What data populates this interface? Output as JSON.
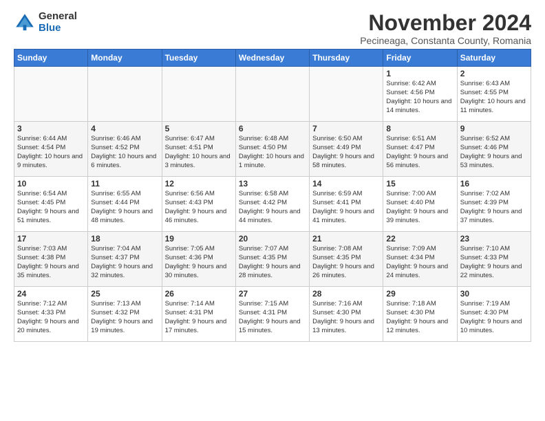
{
  "logo": {
    "general": "General",
    "blue": "Blue"
  },
  "title": "November 2024",
  "subtitle": "Pecineaga, Constanta County, Romania",
  "weekdays": [
    "Sunday",
    "Monday",
    "Tuesday",
    "Wednesday",
    "Thursday",
    "Friday",
    "Saturday"
  ],
  "weeks": [
    [
      {
        "day": "",
        "info": ""
      },
      {
        "day": "",
        "info": ""
      },
      {
        "day": "",
        "info": ""
      },
      {
        "day": "",
        "info": ""
      },
      {
        "day": "",
        "info": ""
      },
      {
        "day": "1",
        "info": "Sunrise: 6:42 AM\nSunset: 4:56 PM\nDaylight: 10 hours and 14 minutes."
      },
      {
        "day": "2",
        "info": "Sunrise: 6:43 AM\nSunset: 4:55 PM\nDaylight: 10 hours and 11 minutes."
      }
    ],
    [
      {
        "day": "3",
        "info": "Sunrise: 6:44 AM\nSunset: 4:54 PM\nDaylight: 10 hours and 9 minutes."
      },
      {
        "day": "4",
        "info": "Sunrise: 6:46 AM\nSunset: 4:52 PM\nDaylight: 10 hours and 6 minutes."
      },
      {
        "day": "5",
        "info": "Sunrise: 6:47 AM\nSunset: 4:51 PM\nDaylight: 10 hours and 3 minutes."
      },
      {
        "day": "6",
        "info": "Sunrise: 6:48 AM\nSunset: 4:50 PM\nDaylight: 10 hours and 1 minute."
      },
      {
        "day": "7",
        "info": "Sunrise: 6:50 AM\nSunset: 4:49 PM\nDaylight: 9 hours and 58 minutes."
      },
      {
        "day": "8",
        "info": "Sunrise: 6:51 AM\nSunset: 4:47 PM\nDaylight: 9 hours and 56 minutes."
      },
      {
        "day": "9",
        "info": "Sunrise: 6:52 AM\nSunset: 4:46 PM\nDaylight: 9 hours and 53 minutes."
      }
    ],
    [
      {
        "day": "10",
        "info": "Sunrise: 6:54 AM\nSunset: 4:45 PM\nDaylight: 9 hours and 51 minutes."
      },
      {
        "day": "11",
        "info": "Sunrise: 6:55 AM\nSunset: 4:44 PM\nDaylight: 9 hours and 48 minutes."
      },
      {
        "day": "12",
        "info": "Sunrise: 6:56 AM\nSunset: 4:43 PM\nDaylight: 9 hours and 46 minutes."
      },
      {
        "day": "13",
        "info": "Sunrise: 6:58 AM\nSunset: 4:42 PM\nDaylight: 9 hours and 44 minutes."
      },
      {
        "day": "14",
        "info": "Sunrise: 6:59 AM\nSunset: 4:41 PM\nDaylight: 9 hours and 41 minutes."
      },
      {
        "day": "15",
        "info": "Sunrise: 7:00 AM\nSunset: 4:40 PM\nDaylight: 9 hours and 39 minutes."
      },
      {
        "day": "16",
        "info": "Sunrise: 7:02 AM\nSunset: 4:39 PM\nDaylight: 9 hours and 37 minutes."
      }
    ],
    [
      {
        "day": "17",
        "info": "Sunrise: 7:03 AM\nSunset: 4:38 PM\nDaylight: 9 hours and 35 minutes."
      },
      {
        "day": "18",
        "info": "Sunrise: 7:04 AM\nSunset: 4:37 PM\nDaylight: 9 hours and 32 minutes."
      },
      {
        "day": "19",
        "info": "Sunrise: 7:05 AM\nSunset: 4:36 PM\nDaylight: 9 hours and 30 minutes."
      },
      {
        "day": "20",
        "info": "Sunrise: 7:07 AM\nSunset: 4:35 PM\nDaylight: 9 hours and 28 minutes."
      },
      {
        "day": "21",
        "info": "Sunrise: 7:08 AM\nSunset: 4:35 PM\nDaylight: 9 hours and 26 minutes."
      },
      {
        "day": "22",
        "info": "Sunrise: 7:09 AM\nSunset: 4:34 PM\nDaylight: 9 hours and 24 minutes."
      },
      {
        "day": "23",
        "info": "Sunrise: 7:10 AM\nSunset: 4:33 PM\nDaylight: 9 hours and 22 minutes."
      }
    ],
    [
      {
        "day": "24",
        "info": "Sunrise: 7:12 AM\nSunset: 4:33 PM\nDaylight: 9 hours and 20 minutes."
      },
      {
        "day": "25",
        "info": "Sunrise: 7:13 AM\nSunset: 4:32 PM\nDaylight: 9 hours and 19 minutes."
      },
      {
        "day": "26",
        "info": "Sunrise: 7:14 AM\nSunset: 4:31 PM\nDaylight: 9 hours and 17 minutes."
      },
      {
        "day": "27",
        "info": "Sunrise: 7:15 AM\nSunset: 4:31 PM\nDaylight: 9 hours and 15 minutes."
      },
      {
        "day": "28",
        "info": "Sunrise: 7:16 AM\nSunset: 4:30 PM\nDaylight: 9 hours and 13 minutes."
      },
      {
        "day": "29",
        "info": "Sunrise: 7:18 AM\nSunset: 4:30 PM\nDaylight: 9 hours and 12 minutes."
      },
      {
        "day": "30",
        "info": "Sunrise: 7:19 AM\nSunset: 4:30 PM\nDaylight: 9 hours and 10 minutes."
      }
    ]
  ]
}
